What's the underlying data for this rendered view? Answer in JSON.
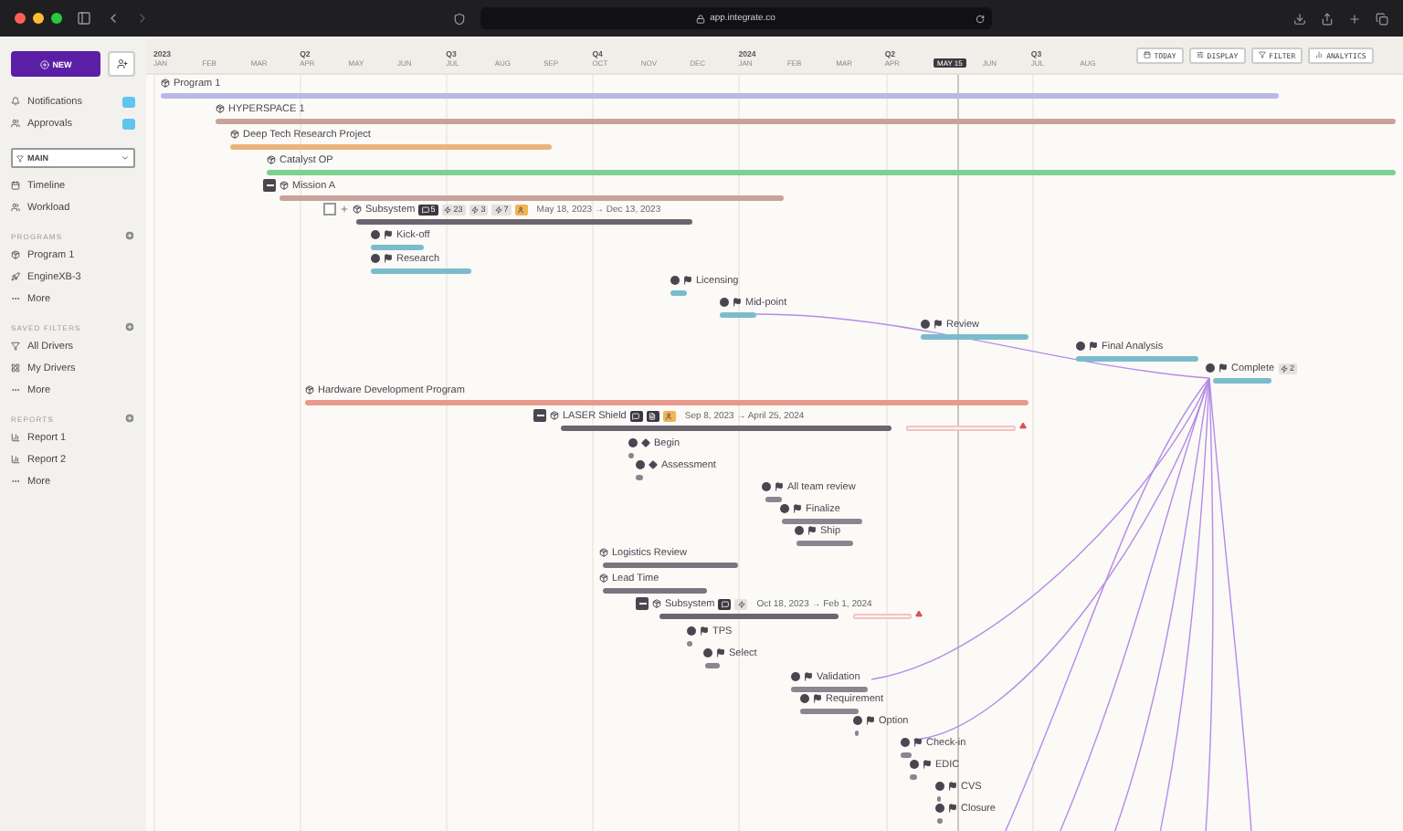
{
  "browser": {
    "url": "app.integrate.co"
  },
  "sidebar": {
    "new_button": "NEW",
    "nav": [
      {
        "label": "Notifications",
        "unread": true
      },
      {
        "label": "Approvals",
        "unread": true
      }
    ],
    "view_select": "MAIN",
    "views": [
      {
        "label": "Timeline",
        "kind": "calendar"
      },
      {
        "label": "Workload",
        "kind": "people"
      }
    ],
    "sections": [
      {
        "title": "PROGRAMS",
        "items": [
          {
            "label": "Program 1",
            "kind": "program"
          },
          {
            "label": "EngineXB-3",
            "kind": "rocket"
          },
          {
            "label": "More",
            "kind": "more"
          }
        ]
      },
      {
        "title": "SAVED FILTERS",
        "items": [
          {
            "label": "All Drivers",
            "kind": "filter"
          },
          {
            "label": "My Drivers",
            "kind": "grid"
          },
          {
            "label": "More",
            "kind": "more"
          }
        ]
      },
      {
        "title": "REPORTS",
        "items": [
          {
            "label": "Report 1",
            "kind": "report"
          },
          {
            "label": "Report 2",
            "kind": "report"
          },
          {
            "label": "More",
            "kind": "more"
          }
        ]
      }
    ]
  },
  "timeline": {
    "months": [
      {
        "label": "JAN",
        "period": "2023"
      },
      {
        "label": "FEB"
      },
      {
        "label": "MAR"
      },
      {
        "label": "APR",
        "period": "Q2"
      },
      {
        "label": "MAY"
      },
      {
        "label": "JUN"
      },
      {
        "label": "JUL",
        "period": "Q3"
      },
      {
        "label": "AUG"
      },
      {
        "label": "SEP"
      },
      {
        "label": "OCT",
        "period": "Q4"
      },
      {
        "label": "NOV"
      },
      {
        "label": "DEC"
      },
      {
        "label": "JAN",
        "period": "2024"
      },
      {
        "label": "FEB"
      },
      {
        "label": "MAR"
      },
      {
        "label": "APR",
        "period": "Q2"
      },
      {
        "label": "MAY",
        "today": true,
        "day": "15"
      },
      {
        "label": "JUN"
      },
      {
        "label": "JUL",
        "period": "Q3"
      },
      {
        "label": "AUG"
      }
    ],
    "toolbar": [
      {
        "label": "TODAY",
        "kind": "calendar"
      },
      {
        "label": "DISPLAY",
        "kind": "display"
      },
      {
        "label": "FILTER",
        "kind": "filter"
      },
      {
        "label": "ANALYTICS",
        "kind": "analytics"
      }
    ]
  },
  "rows": [
    {
      "name": "Program 1",
      "kind": "group",
      "color": "#b9b8e6"
    },
    {
      "name": "HYPERSPACE 1",
      "kind": "group",
      "color": "#c9a29c"
    },
    {
      "name": "Deep Tech Research Project",
      "kind": "group",
      "color": "#e9b47c"
    },
    {
      "name": "Catalyst OP",
      "kind": "group",
      "color": "#7fcf90"
    },
    {
      "name": "Mission A",
      "kind": "group",
      "color": "#c9a29c",
      "expanded": true
    },
    {
      "name": "Subsystem",
      "kind": "task",
      "color": "#6b6570",
      "checked": false,
      "chips": [
        {
          "kind": "comment",
          "label": "5"
        },
        {
          "kind": "count",
          "label": "23"
        },
        {
          "kind": "count",
          "label": "3"
        },
        {
          "kind": "count",
          "label": "7"
        },
        {
          "kind": "owner"
        }
      ],
      "dates": "May 18, 2023 → Dec 13, 2023"
    },
    {
      "name": "Kick-off",
      "kind": "milestone",
      "color": "#7bbccc"
    },
    {
      "name": "Research",
      "kind": "milestone",
      "color": "#7bbccc"
    },
    {
      "name": "Licensing",
      "kind": "milestone",
      "color": "#7bbccc"
    },
    {
      "name": "Mid-point",
      "kind": "milestone",
      "color": "#7bbccc"
    },
    {
      "name": "Review",
      "kind": "milestone",
      "color": "#7bbccc"
    },
    {
      "name": "Final Analysis",
      "kind": "milestone",
      "color": "#7bbccc"
    },
    {
      "name": "Complete",
      "kind": "milestone",
      "color": "#7bbccc",
      "chips": [
        {
          "kind": "count",
          "label": "2"
        }
      ]
    },
    {
      "name": "Hardware Development Program",
      "kind": "group",
      "color": "#e99a8c"
    },
    {
      "name": "LASER Shield",
      "kind": "task",
      "color": "#6b6570",
      "expanded": true,
      "overdue": true,
      "chips": [
        {
          "kind": "comment"
        },
        {
          "kind": "doc"
        },
        {
          "kind": "owner"
        }
      ],
      "dates": "Sep 8, 2023 → April 25, 2024"
    },
    {
      "name": "Begin",
      "kind": "gate",
      "color": "#8a8590"
    },
    {
      "name": "Assessment",
      "kind": "gate",
      "color": "#8a8590"
    },
    {
      "name": "All team review",
      "kind": "milestone",
      "color": "#8a8590"
    },
    {
      "name": "Finalize",
      "kind": "milestone",
      "color": "#8a8590"
    },
    {
      "name": "Ship",
      "kind": "milestone",
      "color": "#8a8590"
    },
    {
      "name": "Logistics Review",
      "kind": "group",
      "color": "#7a7480"
    },
    {
      "name": "Lead Time",
      "kind": "group",
      "color": "#7a7480"
    },
    {
      "name": "Subsystem",
      "kind": "task",
      "color": "#6b6570",
      "expanded": true,
      "overdue": true,
      "chips": [
        {
          "kind": "comment"
        },
        {
          "kind": "count"
        }
      ],
      "dates": "Oct 18, 2023 → Feb 1, 2024"
    },
    {
      "name": "TPS",
      "kind": "milestone",
      "color": "#8a8590"
    },
    {
      "name": "Select",
      "kind": "milestone",
      "color": "#8a8590"
    },
    {
      "name": "Validation",
      "kind": "milestone",
      "color": "#8a8590"
    },
    {
      "name": "Requirement",
      "kind": "milestone",
      "color": "#8a8590"
    },
    {
      "name": "Option",
      "kind": "milestone",
      "color": "#8a8590"
    },
    {
      "name": "Check-in",
      "kind": "milestone",
      "color": "#8a8590"
    },
    {
      "name": "EDIC",
      "kind": "milestone",
      "color": "#8a8590"
    },
    {
      "name": "CVS",
      "kind": "milestone",
      "color": "#8a8590"
    },
    {
      "name": "Closure",
      "kind": "milestone",
      "color": "#8a8590"
    }
  ]
}
